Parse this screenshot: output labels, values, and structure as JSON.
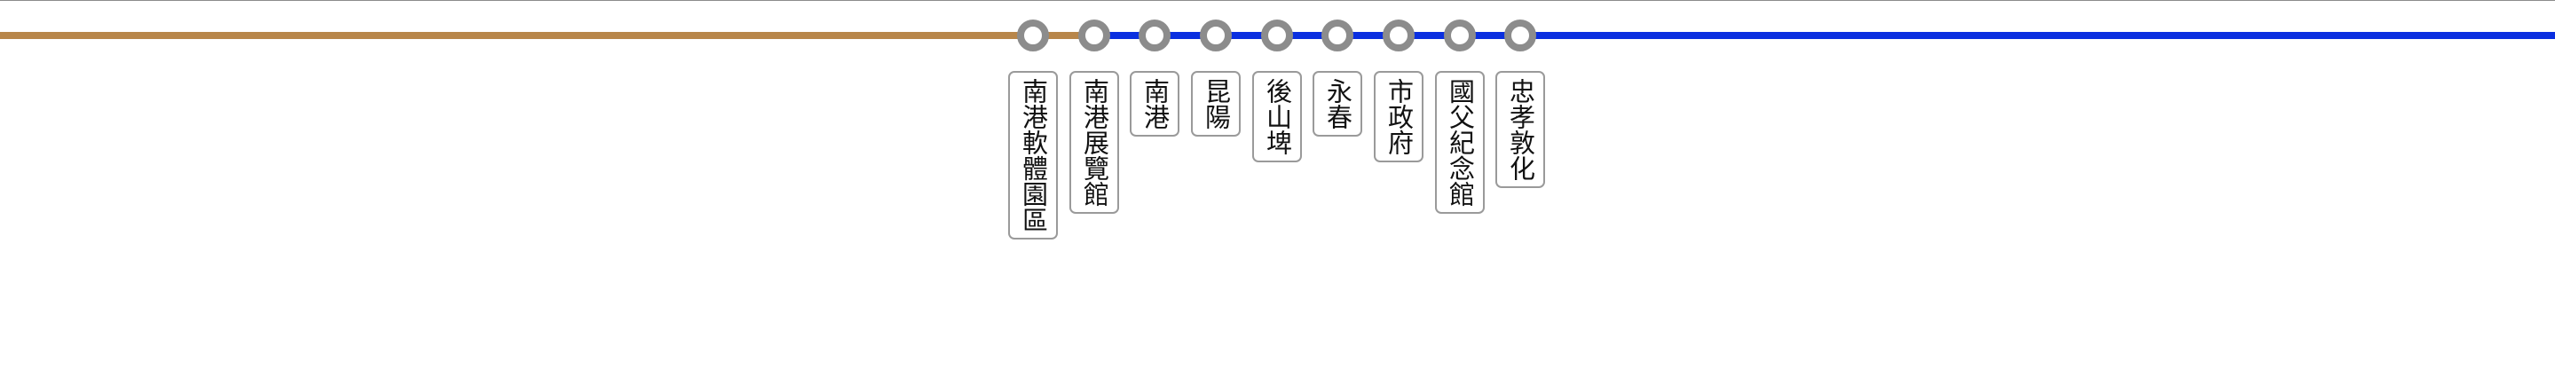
{
  "colors": {
    "line_left": "#B8864A",
    "line_right": "#0A2FE0",
    "station_ring": "#8c8c8c",
    "label_border": "#9a9a9a"
  },
  "line": {
    "stations": [
      {
        "name": "南港軟體園區",
        "segment_after": "brown"
      },
      {
        "name": "南港展覽館",
        "segment_after": "blue"
      },
      {
        "name": "南港",
        "segment_after": "blue"
      },
      {
        "name": "昆陽",
        "segment_after": "blue"
      },
      {
        "name": "後山埤",
        "segment_after": "blue"
      },
      {
        "name": "永春",
        "segment_after": "blue"
      },
      {
        "name": "市政府",
        "segment_after": "blue"
      },
      {
        "name": "國父紀念館",
        "segment_after": "blue"
      },
      {
        "name": "忠孝敦化",
        "segment_after": "blue"
      }
    ]
  }
}
